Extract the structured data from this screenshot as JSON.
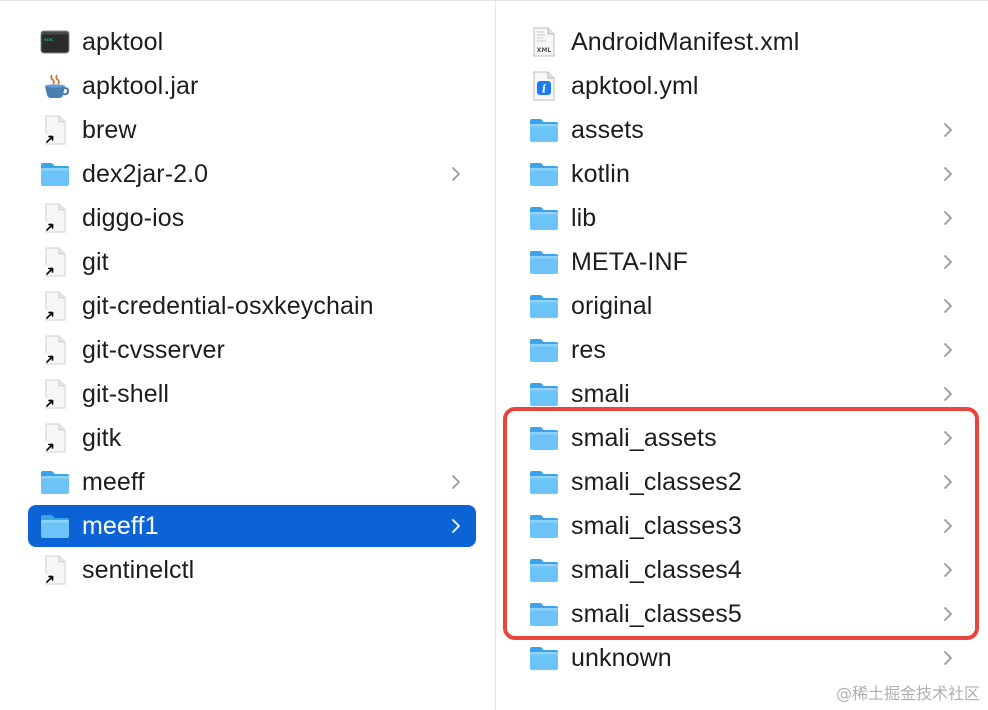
{
  "left_column": {
    "items": [
      {
        "name": "apktool",
        "type": "executable",
        "icon": "terminal-exec-icon",
        "has_children": false,
        "selected": false
      },
      {
        "name": "apktool.jar",
        "type": "jar",
        "icon": "java-jar-icon",
        "has_children": false,
        "selected": false
      },
      {
        "name": "brew",
        "type": "alias",
        "icon": "alias-file-icon",
        "has_children": false,
        "selected": false
      },
      {
        "name": "dex2jar-2.0",
        "type": "folder",
        "icon": "folder-icon",
        "has_children": true,
        "selected": false
      },
      {
        "name": "diggo-ios",
        "type": "alias",
        "icon": "alias-file-icon",
        "has_children": false,
        "selected": false
      },
      {
        "name": "git",
        "type": "alias",
        "icon": "alias-file-icon",
        "has_children": false,
        "selected": false
      },
      {
        "name": "git-credential-osxkeychain",
        "type": "alias",
        "icon": "alias-file-icon",
        "has_children": false,
        "selected": false
      },
      {
        "name": "git-cvsserver",
        "type": "alias",
        "icon": "alias-file-icon",
        "has_children": false,
        "selected": false
      },
      {
        "name": "git-shell",
        "type": "alias",
        "icon": "alias-file-icon",
        "has_children": false,
        "selected": false
      },
      {
        "name": "gitk",
        "type": "alias",
        "icon": "alias-file-icon",
        "has_children": false,
        "selected": false
      },
      {
        "name": "meeff",
        "type": "folder",
        "icon": "folder-icon",
        "has_children": true,
        "selected": false
      },
      {
        "name": "meeff1",
        "type": "folder",
        "icon": "folder-icon",
        "has_children": true,
        "selected": true
      },
      {
        "name": "sentinelctl",
        "type": "alias",
        "icon": "alias-file-icon",
        "has_children": false,
        "selected": false
      }
    ]
  },
  "right_column": {
    "items": [
      {
        "name": "AndroidManifest.xml",
        "type": "xml",
        "icon": "xml-file-icon",
        "has_children": false
      },
      {
        "name": "apktool.yml",
        "type": "yml",
        "icon": "yml-file-icon",
        "has_children": false
      },
      {
        "name": "assets",
        "type": "folder",
        "icon": "folder-icon",
        "has_children": true
      },
      {
        "name": "kotlin",
        "type": "folder",
        "icon": "folder-icon",
        "has_children": true
      },
      {
        "name": "lib",
        "type": "folder",
        "icon": "folder-icon",
        "has_children": true
      },
      {
        "name": "META-INF",
        "type": "folder",
        "icon": "folder-icon",
        "has_children": true
      },
      {
        "name": "original",
        "type": "folder",
        "icon": "folder-icon",
        "has_children": true
      },
      {
        "name": "res",
        "type": "folder",
        "icon": "folder-icon",
        "has_children": true
      },
      {
        "name": "smali",
        "type": "folder",
        "icon": "folder-icon",
        "has_children": true
      },
      {
        "name": "smali_assets",
        "type": "folder",
        "icon": "folder-icon",
        "has_children": true
      },
      {
        "name": "smali_classes2",
        "type": "folder",
        "icon": "folder-icon",
        "has_children": true
      },
      {
        "name": "smali_classes3",
        "type": "folder",
        "icon": "folder-icon",
        "has_children": true
      },
      {
        "name": "smali_classes4",
        "type": "folder",
        "icon": "folder-icon",
        "has_children": true
      },
      {
        "name": "smali_classes5",
        "type": "folder",
        "icon": "folder-icon",
        "has_children": true
      },
      {
        "name": "unknown",
        "type": "folder",
        "icon": "folder-icon",
        "has_children": true
      }
    ]
  },
  "watermark": "@稀土掘金技术社区",
  "colors": {
    "selection": "#0b63d6",
    "folder_light": "#6cc3f7",
    "folder_dark": "#3aa3ea",
    "highlight_box": "#e8453c",
    "text": "#1d1d1f"
  }
}
